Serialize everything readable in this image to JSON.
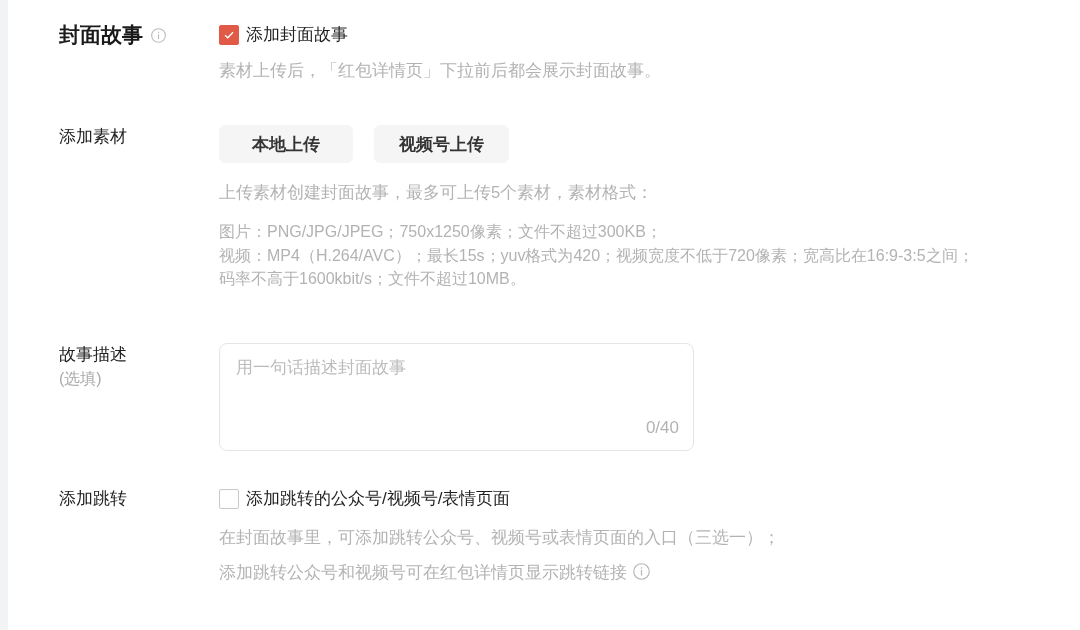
{
  "cover_story": {
    "title": "封面故事",
    "title_info": true,
    "enable_option": {
      "label": "添加封面故事",
      "checked": true
    },
    "hint": "素材上传后，「红包详情页」下拉前后都会展示封面故事。"
  },
  "fields": [
    {
      "kind": "upload",
      "label": "添加素材",
      "buttons": [
        "本地上传",
        "视频号上传"
      ],
      "hint": "上传素材创建封面故事，最多可上传5个素材，素材格式：",
      "format_lines": [
        "图片：PNG/JPG/JPEG；750x1250像素；文件不超过300KB；",
        "视频：MP4（H.264/AVC）；最长15s；yuv格式为420；视频宽度不低于720像素；宽高比在16:9-3:5之间；",
        "码率不高于1600kbit/s；文件不超过10MB。"
      ]
    },
    {
      "kind": "textarea",
      "label": "故事描述",
      "sublabel": "(选填)",
      "placeholder": "用一句话描述封面故事",
      "counter": "0/40"
    },
    {
      "kind": "checkbox",
      "label": "添加跳转",
      "option": {
        "label": "添加跳转的公众号/视频号/表情页面",
        "checked": false
      },
      "hints": [
        {
          "text": "在封面故事里，可添加跳转公众号、视频号或表情页面的入口（三选一）；",
          "info": false
        },
        {
          "text": "添加跳转公众号和视频号可在红包详情页显示跳转链接",
          "info": true
        }
      ]
    }
  ]
}
